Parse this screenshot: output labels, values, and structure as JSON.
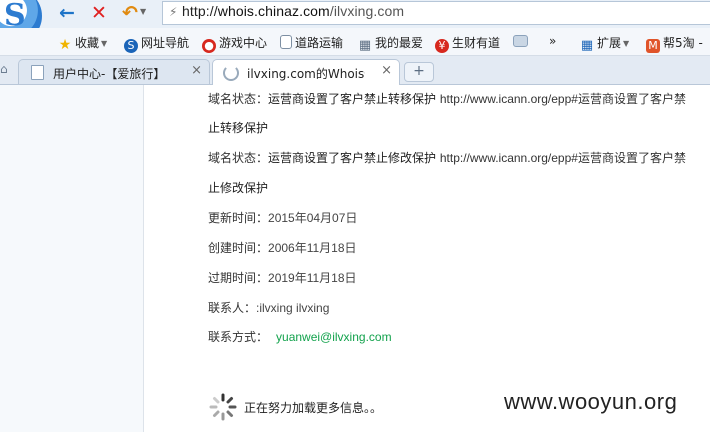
{
  "toolbar": {
    "back_icon": "arrow-left-icon",
    "stop_icon": "close-icon",
    "undo_icon": "undo-icon",
    "url_prefix": "http://",
    "url_host": "whois.chinaz.com",
    "url_path": "/ilvxing.com"
  },
  "bookmarks": {
    "items": [
      {
        "label": "收藏",
        "icon": "star-icon"
      },
      {
        "label": "网址导航",
        "icon": "sogou-icon"
      },
      {
        "label": "游戏中心",
        "icon": "game-icon"
      },
      {
        "label": "道路运输",
        "icon": "page-icon"
      },
      {
        "label": "我的最爱",
        "icon": "grid-icon"
      },
      {
        "label": "生财有道",
        "icon": "money-icon"
      },
      {
        "label": "",
        "icon": "folder-icon"
      },
      {
        "label": "»",
        "icon": ""
      },
      {
        "label": "扩展",
        "icon": "apps-icon"
      },
      {
        "label": "帮5淘 - ",
        "icon": "m-icon"
      }
    ]
  },
  "tabs": [
    {
      "label": "用户中心-【爱旅行】",
      "close": "×"
    },
    {
      "label": "ilvxing.com的Whois信息",
      "close": "×"
    }
  ],
  "new_tab_label": "+",
  "whois": {
    "status1_label": "域名状态：",
    "status1_value": "运营商设置了客户禁止转移保护",
    "status1_url": "http://www.icann.org/epp#运营商设置了客户禁",
    "status1_wrap": "止转移保护",
    "status2_label": "域名状态：",
    "status2_value": "运营商设置了客户禁止修改保护",
    "status2_url": "http://www.icann.org/epp#运营商设置了客户禁",
    "status2_wrap": "止修改保护",
    "updated_label": "更新时间：",
    "updated_value": "2015年04月07日",
    "created_label": "创建时间：",
    "created_value": "2006年11月18日",
    "expires_label": "过期时间：",
    "expires_value": "2019年11月18日",
    "contact_label": "联系人：",
    "contact_value": ":ilvxing ilvxing",
    "contact_method_label": "联系方式：",
    "contact_email": "yuanwei@ilvxing.com"
  },
  "loading_text": "正在努力加载更多信息。。",
  "watermark": "www.wooyun.org"
}
